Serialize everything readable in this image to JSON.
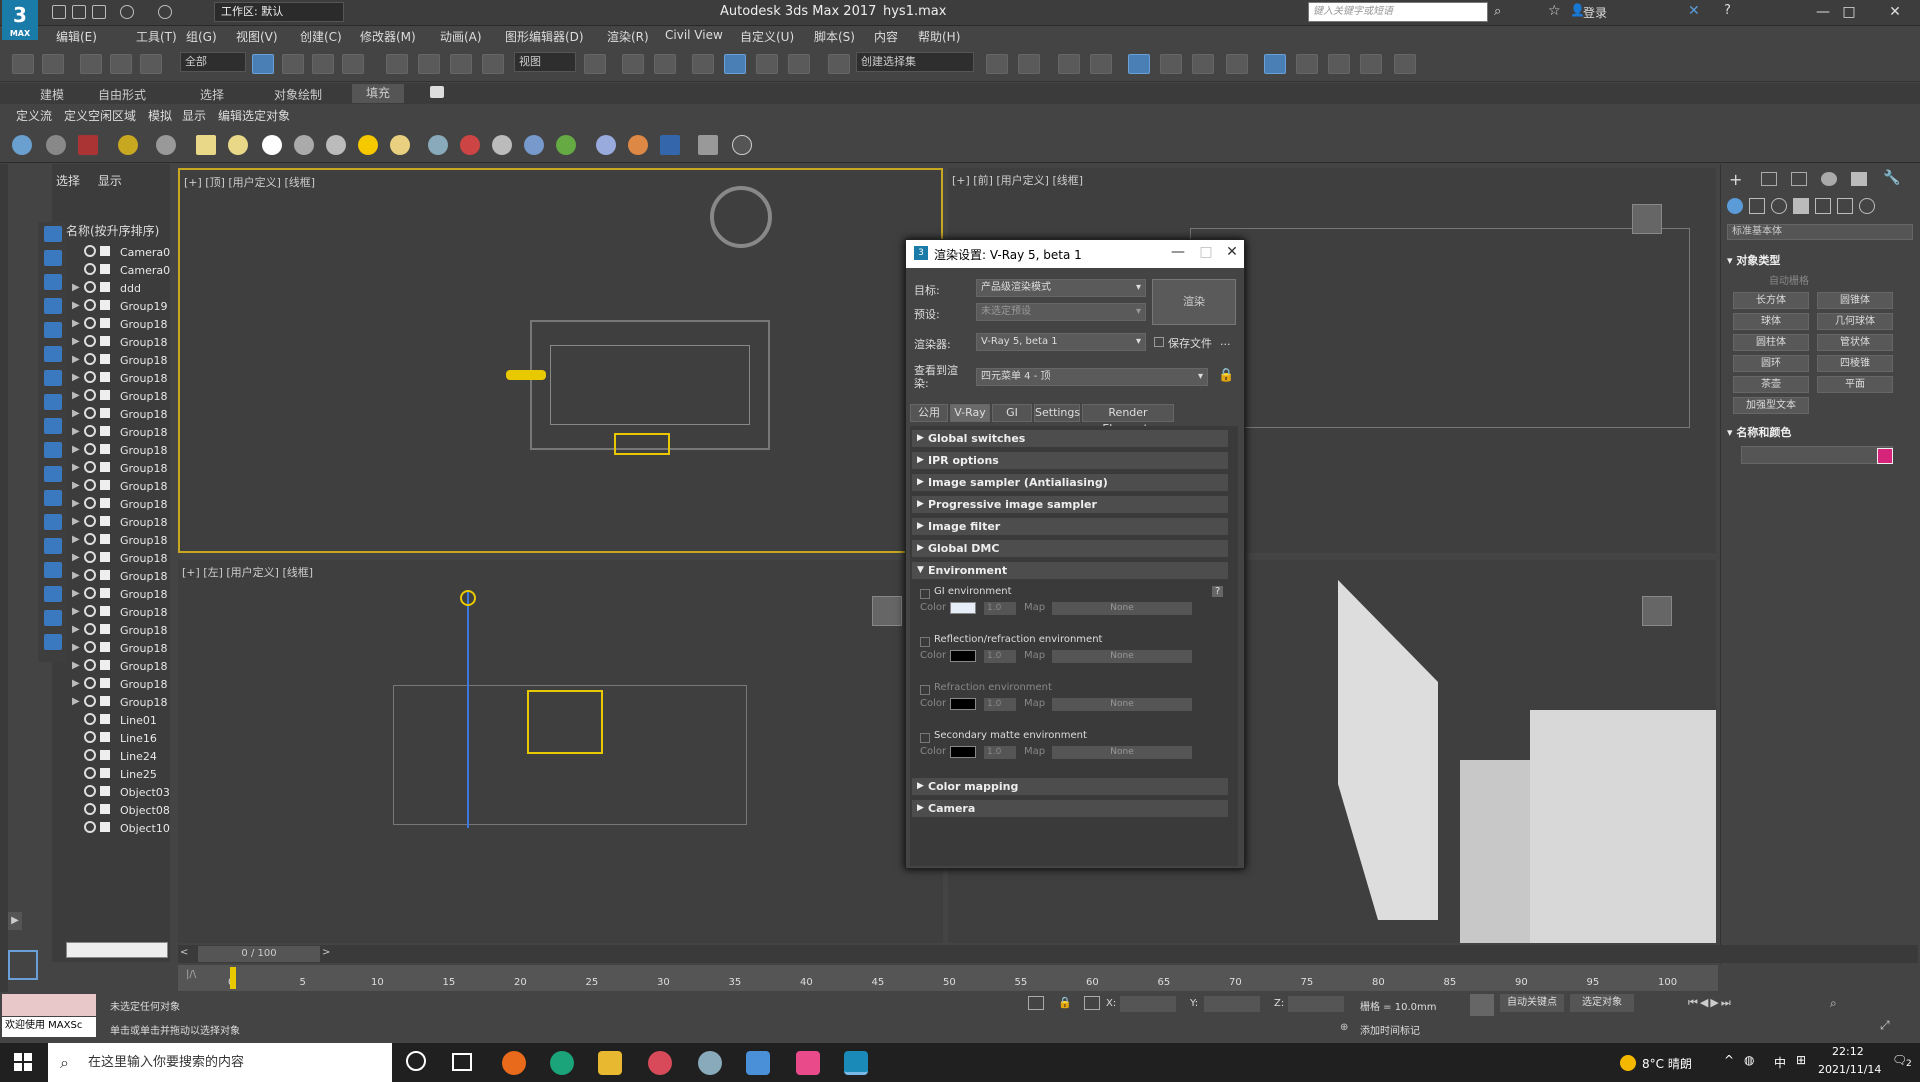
{
  "titlebar": {
    "app_title": "Autodesk 3ds Max 2017",
    "file_name": "hys1.max",
    "workspace": "工作区: 默认",
    "search_placeholder": "键入关键字或短语",
    "login": "登录",
    "logo": "3",
    "logo_sub": "MAX",
    "minimize": "—",
    "maximize": "□",
    "close": "✕"
  },
  "menu": [
    "编辑(E)",
    "工具(T)",
    "组(G)",
    "视图(V)",
    "创建(C)",
    "修改器(M)",
    "动画(A)",
    "图形编辑器(D)",
    "渲染(R)",
    "Civil View",
    "自定义(U)",
    "脚本(S)",
    "内容",
    "帮助(H)"
  ],
  "toolbar": {
    "filter": "全部",
    "view": "视图",
    "selection_set": "创建选择集"
  },
  "ribbon_tabs": [
    "建模",
    "自由形式",
    "选择",
    "对象绘制",
    "填充"
  ],
  "ribbon_sub": [
    "定义流",
    "定义空闲区域",
    "模拟",
    "显示",
    "编辑选定对象"
  ],
  "explorer": {
    "tabs": [
      "选择",
      "显示"
    ],
    "header": "名称(按升序排序)",
    "items": [
      {
        "label": "Camera0",
        "arrow": ""
      },
      {
        "label": "Camera0",
        "arrow": ""
      },
      {
        "label": "ddd",
        "arrow": "▶"
      },
      {
        "label": "Group19",
        "arrow": "▶"
      },
      {
        "label": "Group18",
        "arrow": "▶"
      },
      {
        "label": "Group18",
        "arrow": "▶"
      },
      {
        "label": "Group18",
        "arrow": "▶"
      },
      {
        "label": "Group18",
        "arrow": "▶"
      },
      {
        "label": "Group18",
        "arrow": "▶"
      },
      {
        "label": "Group18",
        "arrow": "▶"
      },
      {
        "label": "Group18",
        "arrow": "▶"
      },
      {
        "label": "Group18",
        "arrow": "▶"
      },
      {
        "label": "Group18",
        "arrow": "▶"
      },
      {
        "label": "Group18",
        "arrow": "▶"
      },
      {
        "label": "Group18",
        "arrow": "▶"
      },
      {
        "label": "Group18",
        "arrow": "▶"
      },
      {
        "label": "Group18",
        "arrow": "▶"
      },
      {
        "label": "Group18",
        "arrow": "▶"
      },
      {
        "label": "Group18",
        "arrow": "▶"
      },
      {
        "label": "Group18",
        "arrow": "▶"
      },
      {
        "label": "Group18",
        "arrow": "▶"
      },
      {
        "label": "Group18",
        "arrow": "▶"
      },
      {
        "label": "Group18",
        "arrow": "▶"
      },
      {
        "label": "Group18",
        "arrow": "▶"
      },
      {
        "label": "Group18",
        "arrow": "▶"
      },
      {
        "label": "Group18",
        "arrow": "▶"
      },
      {
        "label": "Line01",
        "arrow": ""
      },
      {
        "label": "Line16",
        "arrow": ""
      },
      {
        "label": "Line24",
        "arrow": ""
      },
      {
        "label": "Line25",
        "arrow": ""
      },
      {
        "label": "Object03",
        "arrow": ""
      },
      {
        "label": "Object08",
        "arrow": ""
      },
      {
        "label": "Object10",
        "arrow": ""
      }
    ]
  },
  "viewports": {
    "top_left": "[+] [顶] [用户定义] [线框]",
    "top_right": "[+] [前] [用户定义] [线框]",
    "bottom_left": "[+] [左] [用户定义] [线框]"
  },
  "command_panel": {
    "category": "标准基本体",
    "section_type": "对象类型",
    "autogrid": "自动栅格",
    "section_name": "名称和颜色",
    "accent": "#d6247a",
    "buttons": [
      "长方体",
      "圆锥体",
      "球体",
      "几何球体",
      "圆柱体",
      "管状体",
      "圆环",
      "四棱锥",
      "茶壶",
      "平面",
      "加强型文本"
    ]
  },
  "dialog": {
    "title": "渲染设置: V-Ray 5, beta 1",
    "target_label": "目标:",
    "target_value": "产品级渲染模式",
    "preset_label": "预设:",
    "preset_value": "未选定预设",
    "renderer_label": "渲染器:",
    "renderer_value": "V-Ray 5, beta 1",
    "save_file": "保存文件",
    "more": "...",
    "view_label": "查看到渲染:",
    "view_value": "四元菜单 4 - 顶",
    "render_button": "渲染",
    "tabs": [
      "公用",
      "V-Ray",
      "GI",
      "Settings",
      "Render Elements"
    ],
    "rollouts_top": [
      "Global switches",
      "IPR options",
      "Image sampler (Antialiasing)",
      "Progressive image sampler",
      "Image filter",
      "Global DMC"
    ],
    "environment": "Environment",
    "help": "?",
    "env_groups": [
      {
        "title": "GI environment",
        "color": "#e8eef8",
        "dim": false
      },
      {
        "title": "Reflection/refraction environment",
        "color": "#000000",
        "dim": false
      },
      {
        "title": "Refraction environment",
        "color": "#000000",
        "dim": true
      },
      {
        "title": "Secondary matte environment",
        "color": "#000000",
        "dim": false
      }
    ],
    "color_label": "Color",
    "multiplier": "1.0",
    "map_label": "Map",
    "none_label": "None",
    "rollouts_bottom": [
      "Color mapping",
      "Camera"
    ]
  },
  "timeline": {
    "frame": "0 / 100",
    "ticks": [
      "0",
      "5",
      "10",
      "15",
      "20",
      "25",
      "30",
      "35",
      "40",
      "45",
      "50",
      "55",
      "60",
      "65",
      "70",
      "75",
      "80",
      "85",
      "90",
      "95",
      "100"
    ]
  },
  "status": {
    "line1": "未选定任何对象",
    "line2": "单击或单击并拖动以选择对象",
    "maxscript": "欢迎使用 MAXSc",
    "x": "X:",
    "y": "Y:",
    "z": "Z:",
    "grid": "栅格 = 10.0mm",
    "add_tag": "添加时间标记",
    "auto_key": "自动关键点",
    "selected": "选定对象"
  },
  "taskbar": {
    "search": "在这里输入你要搜索的内容",
    "weather": "8°C 晴朗",
    "ime": "中",
    "time": "22:12",
    "date": "2021/11/14",
    "notif": "2"
  }
}
